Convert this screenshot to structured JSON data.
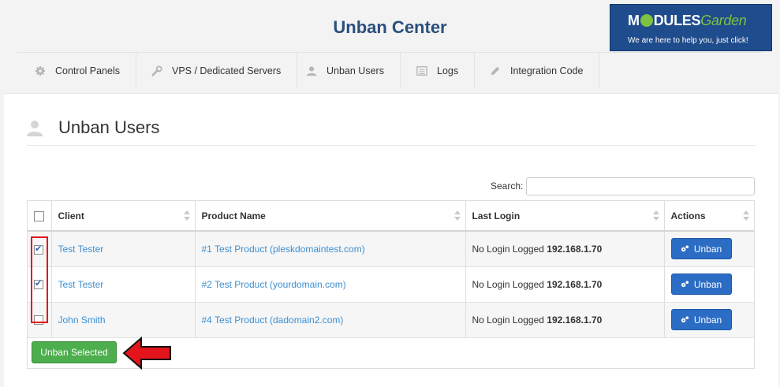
{
  "header": {
    "title": "Unban Center",
    "brand": {
      "name_part1": "M",
      "name_part2": "DULES",
      "name_part3": "Garden",
      "tagline": "We are here to help you, just click!"
    },
    "nav": [
      {
        "label": "Control Panels",
        "icon": "gear-icon"
      },
      {
        "label": "VPS / Dedicated Servers",
        "icon": "wrench-icon"
      },
      {
        "label": "Unban Users",
        "icon": "user-icon"
      },
      {
        "label": "Logs",
        "icon": "list-icon"
      },
      {
        "label": "Integration Code",
        "icon": "pencil-icon"
      }
    ]
  },
  "page": {
    "title": "Unban Users"
  },
  "search": {
    "label": "Search:",
    "value": ""
  },
  "table": {
    "columns": [
      "Client",
      "Product Name",
      "Last Login",
      "Actions"
    ],
    "rows": [
      {
        "checked": true,
        "client": "Test Tester",
        "product": "#1 Test Product (pleskdomaintest.com)",
        "login_text": "No Login Logged",
        "ip": "192.168.1.70",
        "action": "Unban"
      },
      {
        "checked": true,
        "client": "Test Tester",
        "product": "#2 Test Product (yourdomain.com)",
        "login_text": "No Login Logged",
        "ip": "192.168.1.70",
        "action": "Unban"
      },
      {
        "checked": false,
        "client": "John Smith",
        "product": "#4 Test Product (dadomain2.com)",
        "login_text": "No Login Logged",
        "ip": "192.168.1.70",
        "action": "Unban"
      }
    ]
  },
  "actions": {
    "unban_selected": "Unban Selected"
  },
  "colors": {
    "accent": "#2b6cc4",
    "success": "#4cae4c",
    "highlight": "#e3141b",
    "title": "#2a4f7d",
    "link": "#3d8fd1"
  }
}
